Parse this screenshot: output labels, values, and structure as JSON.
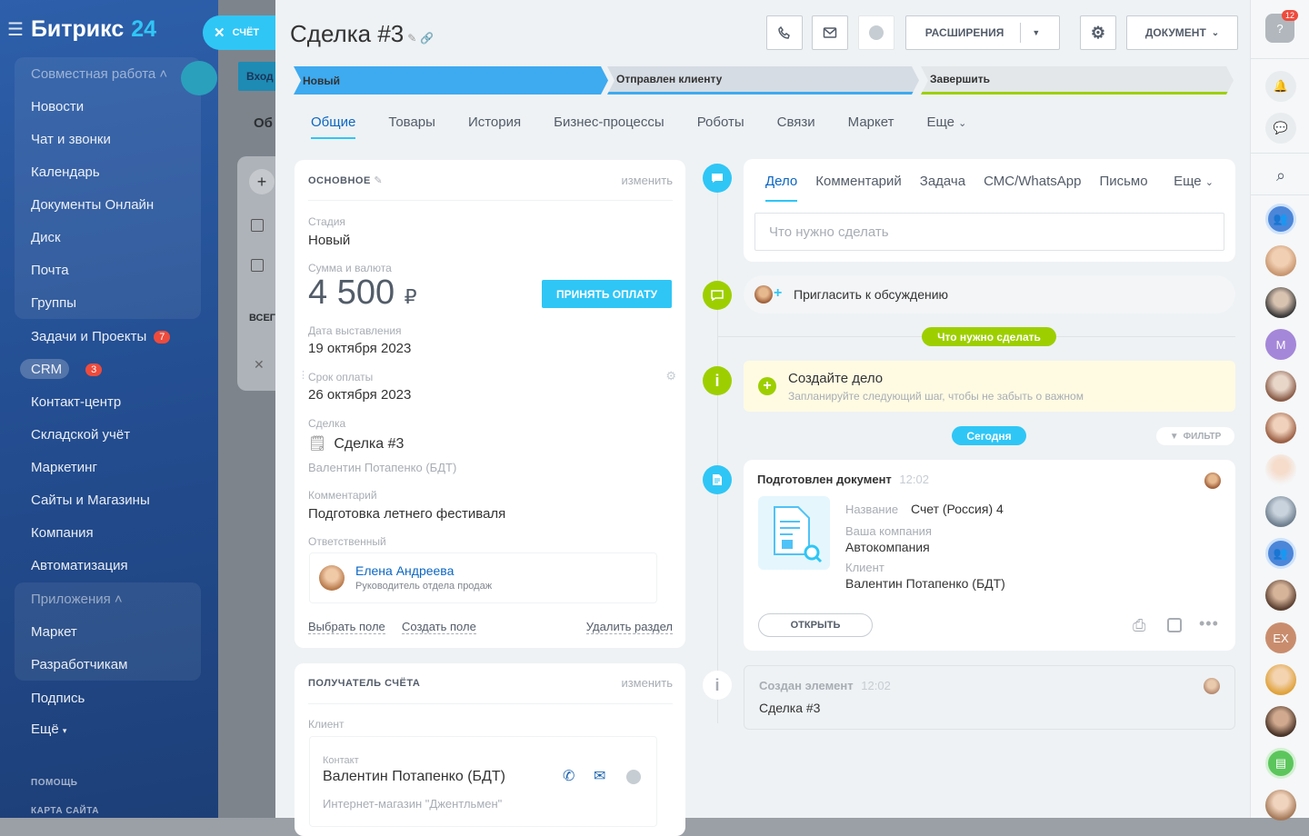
{
  "sidebar": {
    "logo": {
      "name": "Битрикс",
      "number": "24"
    },
    "group1_title": "Совместная работа",
    "items": [
      "Новости",
      "Чат и звонки",
      "Календарь",
      "Документы Онлайн",
      "Диск",
      "Почта",
      "Группы"
    ],
    "tasks": {
      "label": "Задачи и Проекты",
      "badge": "7"
    },
    "crm": {
      "label": "CRM",
      "badge": "3"
    },
    "items2": [
      "Контакт-центр",
      "Складской учёт",
      "Маркетинг",
      "Сайты и Магазины",
      "Компания",
      "Автоматизация"
    ],
    "group2_title": "Приложения",
    "apps": [
      "Маркет",
      "Разработчикам"
    ],
    "subscription": "Подпись",
    "more": "Ещё",
    "help": "ПОМОЩЬ",
    "sitemap": "КАРТА САЙТА"
  },
  "bg": {
    "inbox": "Вход",
    "tab": "Об",
    "all": "ВСЕГ"
  },
  "slider": {
    "close_label": "СЧЁТ"
  },
  "header": {
    "title": "Сделка #3",
    "extensions_label": "РАСШИРЕНИЯ",
    "document_label": "ДОКУМЕНТ"
  },
  "stages": [
    {
      "label": "Новый",
      "color": "#3eaaf0"
    },
    {
      "label": "Отправлен клиенту",
      "color": "#d5dce3"
    },
    {
      "label": "Завершить",
      "color": "#e3e7ea"
    }
  ],
  "tabs": [
    "Общие",
    "Товары",
    "История",
    "Бизнес-процессы",
    "Роботы",
    "Связи",
    "Маркет",
    "Еще"
  ],
  "main_section": {
    "title": "ОСНОВНОЕ",
    "edit": "изменить",
    "stage_label": "Стадия",
    "stage_value": "Новый",
    "amount_label": "Сумма и валюта",
    "amount_value": "4 500",
    "currency": "₽",
    "pay_button": "ПРИНЯТЬ ОПЛАТУ",
    "date_label": "Дата выставления",
    "date_value": "19 октября 2023",
    "due_label": "Срок оплаты",
    "due_value": "26 октября 2023",
    "deal_label": "Сделка",
    "deal_value": "Сделка #3",
    "deal_client": "Валентин Потапенко (БДТ)",
    "comment_label": "Комментарий",
    "comment_value": "Подготовка летнего фестиваля",
    "responsible_label": "Ответственный",
    "responsible_name": "Елена Андреева",
    "responsible_role": "Руководитель отдела продаж",
    "select_field": "Выбрать поле",
    "create_field": "Создать поле",
    "delete_section": "Удалить раздел"
  },
  "recipient": {
    "title": "ПОЛУЧАТЕЛЬ СЧЁТА",
    "edit": "изменить",
    "client_label": "Клиент",
    "contact_label": "Контакт",
    "contact_name": "Валентин Потапенко (БДТ)",
    "company": "Интернет-магазин \"Джентльмен\""
  },
  "activity": {
    "tabs": [
      "Дело",
      "Комментарий",
      "Задача",
      "СМС/WhatsApp",
      "Письмо"
    ],
    "more": "Еще",
    "placeholder": "Что нужно сделать",
    "invite": "Пригласить к обсуждению",
    "todo_pill": "Что нужно сделать",
    "create_title": "Создайте дело",
    "create_sub": "Запланируйте следующий шаг, чтобы не забыть о важном",
    "today_pill": "Сегодня",
    "filter": "ФИЛЬТР"
  },
  "doc_event": {
    "title": "Подготовлен документ",
    "time": "12:02",
    "name_label": "Название",
    "name_value": "Счет (Россия) 4",
    "company_label": "Ваша компания",
    "company_value": "Автокомпания",
    "client_label": "Клиент",
    "client_value": "Валентин Потапенко (БДТ)",
    "open_button": "ОТКРЫТЬ"
  },
  "created_event": {
    "title": "Создан элемент",
    "time": "12:02",
    "value": "Сделка #3"
  },
  "right_bar": {
    "help_badge": "12",
    "avatar_m": "M",
    "avatar_ex": "EX"
  },
  "colors": {
    "accent": "#2fc6f6",
    "green": "#9dcf00",
    "link": "#0b66c3",
    "sidebar": "#2d5faa"
  }
}
